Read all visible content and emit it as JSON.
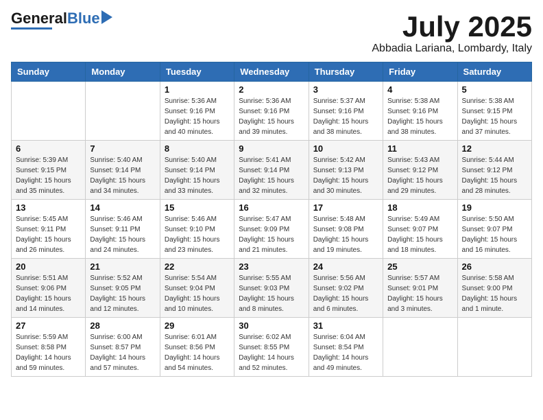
{
  "header": {
    "logo_general": "General",
    "logo_blue": "Blue",
    "month_title": "July 2025",
    "location": "Abbadia Lariana, Lombardy, Italy"
  },
  "weekdays": [
    "Sunday",
    "Monday",
    "Tuesday",
    "Wednesday",
    "Thursday",
    "Friday",
    "Saturday"
  ],
  "weeks": [
    [
      {
        "day": "",
        "info": ""
      },
      {
        "day": "",
        "info": ""
      },
      {
        "day": "1",
        "info": "Sunrise: 5:36 AM\nSunset: 9:16 PM\nDaylight: 15 hours and 40 minutes."
      },
      {
        "day": "2",
        "info": "Sunrise: 5:36 AM\nSunset: 9:16 PM\nDaylight: 15 hours and 39 minutes."
      },
      {
        "day": "3",
        "info": "Sunrise: 5:37 AM\nSunset: 9:16 PM\nDaylight: 15 hours and 38 minutes."
      },
      {
        "day": "4",
        "info": "Sunrise: 5:38 AM\nSunset: 9:16 PM\nDaylight: 15 hours and 38 minutes."
      },
      {
        "day": "5",
        "info": "Sunrise: 5:38 AM\nSunset: 9:15 PM\nDaylight: 15 hours and 37 minutes."
      }
    ],
    [
      {
        "day": "6",
        "info": "Sunrise: 5:39 AM\nSunset: 9:15 PM\nDaylight: 15 hours and 35 minutes."
      },
      {
        "day": "7",
        "info": "Sunrise: 5:40 AM\nSunset: 9:14 PM\nDaylight: 15 hours and 34 minutes."
      },
      {
        "day": "8",
        "info": "Sunrise: 5:40 AM\nSunset: 9:14 PM\nDaylight: 15 hours and 33 minutes."
      },
      {
        "day": "9",
        "info": "Sunrise: 5:41 AM\nSunset: 9:14 PM\nDaylight: 15 hours and 32 minutes."
      },
      {
        "day": "10",
        "info": "Sunrise: 5:42 AM\nSunset: 9:13 PM\nDaylight: 15 hours and 30 minutes."
      },
      {
        "day": "11",
        "info": "Sunrise: 5:43 AM\nSunset: 9:12 PM\nDaylight: 15 hours and 29 minutes."
      },
      {
        "day": "12",
        "info": "Sunrise: 5:44 AM\nSunset: 9:12 PM\nDaylight: 15 hours and 28 minutes."
      }
    ],
    [
      {
        "day": "13",
        "info": "Sunrise: 5:45 AM\nSunset: 9:11 PM\nDaylight: 15 hours and 26 minutes."
      },
      {
        "day": "14",
        "info": "Sunrise: 5:46 AM\nSunset: 9:11 PM\nDaylight: 15 hours and 24 minutes."
      },
      {
        "day": "15",
        "info": "Sunrise: 5:46 AM\nSunset: 9:10 PM\nDaylight: 15 hours and 23 minutes."
      },
      {
        "day": "16",
        "info": "Sunrise: 5:47 AM\nSunset: 9:09 PM\nDaylight: 15 hours and 21 minutes."
      },
      {
        "day": "17",
        "info": "Sunrise: 5:48 AM\nSunset: 9:08 PM\nDaylight: 15 hours and 19 minutes."
      },
      {
        "day": "18",
        "info": "Sunrise: 5:49 AM\nSunset: 9:07 PM\nDaylight: 15 hours and 18 minutes."
      },
      {
        "day": "19",
        "info": "Sunrise: 5:50 AM\nSunset: 9:07 PM\nDaylight: 15 hours and 16 minutes."
      }
    ],
    [
      {
        "day": "20",
        "info": "Sunrise: 5:51 AM\nSunset: 9:06 PM\nDaylight: 15 hours and 14 minutes."
      },
      {
        "day": "21",
        "info": "Sunrise: 5:52 AM\nSunset: 9:05 PM\nDaylight: 15 hours and 12 minutes."
      },
      {
        "day": "22",
        "info": "Sunrise: 5:54 AM\nSunset: 9:04 PM\nDaylight: 15 hours and 10 minutes."
      },
      {
        "day": "23",
        "info": "Sunrise: 5:55 AM\nSunset: 9:03 PM\nDaylight: 15 hours and 8 minutes."
      },
      {
        "day": "24",
        "info": "Sunrise: 5:56 AM\nSunset: 9:02 PM\nDaylight: 15 hours and 6 minutes."
      },
      {
        "day": "25",
        "info": "Sunrise: 5:57 AM\nSunset: 9:01 PM\nDaylight: 15 hours and 3 minutes."
      },
      {
        "day": "26",
        "info": "Sunrise: 5:58 AM\nSunset: 9:00 PM\nDaylight: 15 hours and 1 minute."
      }
    ],
    [
      {
        "day": "27",
        "info": "Sunrise: 5:59 AM\nSunset: 8:58 PM\nDaylight: 14 hours and 59 minutes."
      },
      {
        "day": "28",
        "info": "Sunrise: 6:00 AM\nSunset: 8:57 PM\nDaylight: 14 hours and 57 minutes."
      },
      {
        "day": "29",
        "info": "Sunrise: 6:01 AM\nSunset: 8:56 PM\nDaylight: 14 hours and 54 minutes."
      },
      {
        "day": "30",
        "info": "Sunrise: 6:02 AM\nSunset: 8:55 PM\nDaylight: 14 hours and 52 minutes."
      },
      {
        "day": "31",
        "info": "Sunrise: 6:04 AM\nSunset: 8:54 PM\nDaylight: 14 hours and 49 minutes."
      },
      {
        "day": "",
        "info": ""
      },
      {
        "day": "",
        "info": ""
      }
    ]
  ]
}
